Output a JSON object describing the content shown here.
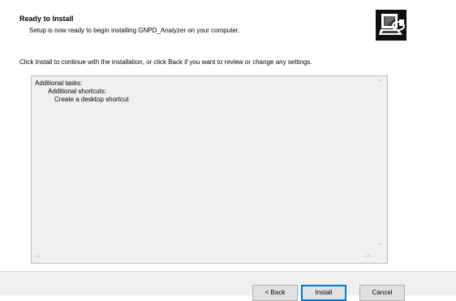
{
  "header": {
    "title": "Ready to Install",
    "subtitle": "Setup is now ready to begin installing GNPD_Analyzer on your computer.",
    "logo_icon": "installer-computer-icon"
  },
  "instruction": "Click Install to continue with the installation, or click Back if you want to review or change any settings.",
  "memo": {
    "lines": [
      "Additional tasks:",
      "Additional shortcuts:",
      "Create a desktop shortcut"
    ]
  },
  "buttons": {
    "back": "< Back",
    "install": "Install",
    "cancel": "Cancel"
  }
}
